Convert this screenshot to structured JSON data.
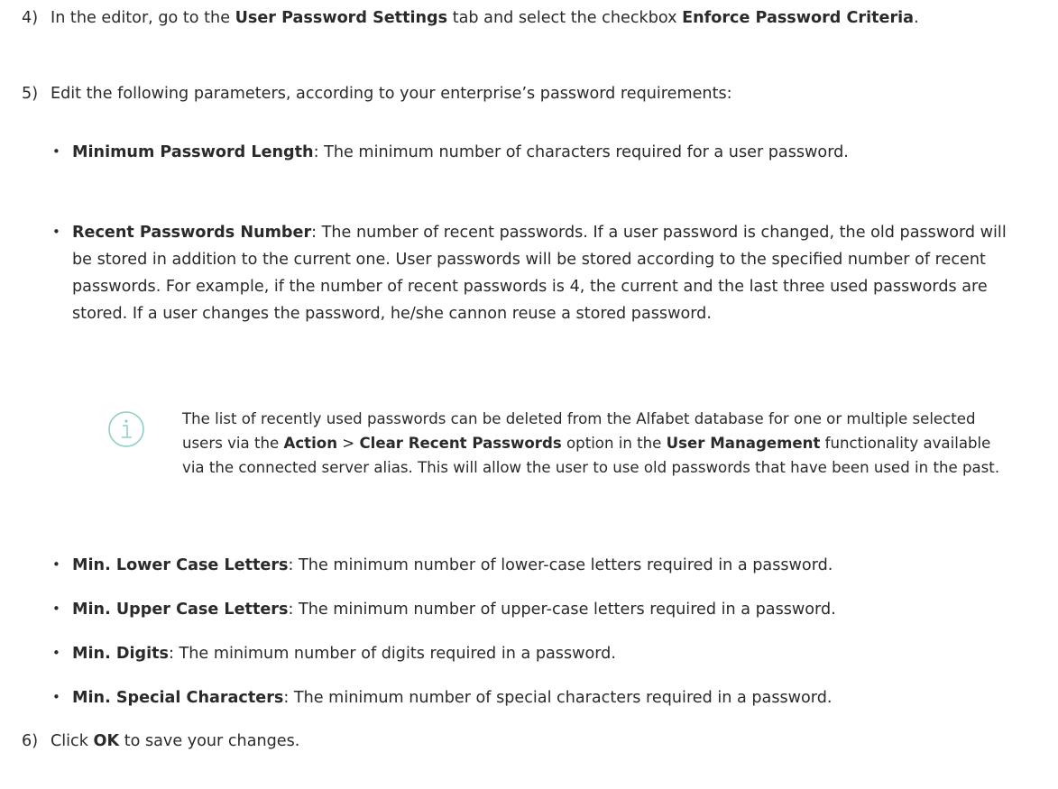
{
  "step4": {
    "number": "4)",
    "pre": "In the editor, go to the ",
    "tab": "User Password Settings",
    "mid": " tab and select the checkbox ",
    "checkbox": "Enforce Password Criteria",
    "post": "."
  },
  "step5": {
    "number": "5)",
    "text": "Edit the following parameters, according to your enterprise’s password requirements:"
  },
  "params": [
    {
      "name": "Minimum Password Length",
      "desc": ": The minimum number of characters required for a user password."
    },
    {
      "name": "Recent Passwords Number",
      "desc": ": The number of recent passwords. If a user password is changed, the old password will be stored in addition to the current one. User passwords will be stored according to the specified number of recent passwords. For example, if the number of recent passwords is 4, the current and the last three used passwords are stored. If a user changes the password, he/she cannon reuse a stored password."
    },
    {
      "name": "Min. Lower Case Letters",
      "desc": ": The minimum number of lower-case letters required in a password."
    },
    {
      "name": "Min. Upper Case Letters",
      "desc": ": The minimum number of upper-case letters required in a password."
    },
    {
      "name": "Min. Digits",
      "desc": ": The minimum number of digits required in a password."
    },
    {
      "name": "Min. Special Characters",
      "desc": ": The minimum number of special characters required in a password."
    }
  ],
  "note": {
    "icon": "info-icon",
    "pre": "The list of recently used passwords can be deleted from the Alfabet database for one or multiple selected users via the ",
    "action": "Action",
    "sep": " > ",
    "clear": "Clear Recent Passwords",
    "mid": " option in the ",
    "um": "User Management",
    "post": " functionality available via the connected server alias. This will allow the user to use old passwords that have been used in the past."
  },
  "step6": {
    "number": "6)",
    "pre": "Click ",
    "ok": "OK",
    "post": " to save your changes."
  },
  "colors": {
    "text": "#2a2a2a",
    "icon": "#8fcfc7"
  }
}
